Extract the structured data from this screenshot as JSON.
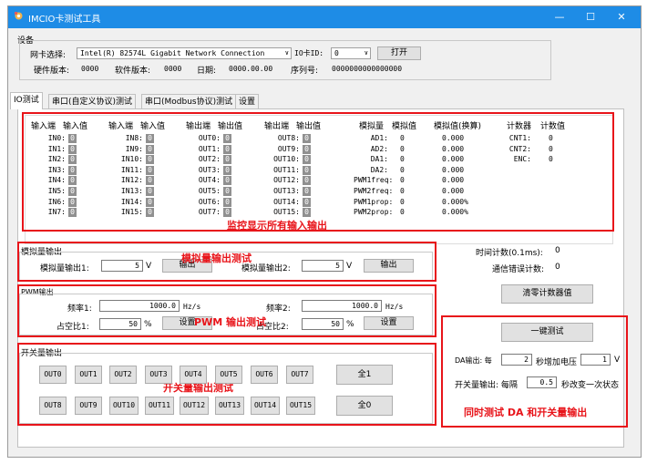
{
  "window": {
    "title": "IMCIO卡测试工具",
    "min_glyph": "—",
    "max_glyph": "☐",
    "close_glyph": "✕"
  },
  "device": {
    "group_label": "设备",
    "nic_label": "网卡选择:",
    "nic_value": "Intel(R) 82574L Gigabit Network Connection",
    "ioid_label": "IO卡ID:",
    "ioid_value": "0",
    "open_button": "打开",
    "hw_label": "硬件版本:",
    "hw_value": "0000",
    "sw_label": "软件版本:",
    "sw_value": "0000",
    "date_label": "日期:",
    "date_value": "0000.00.00",
    "serial_label": "序列号:",
    "serial_value": "0000000000000000"
  },
  "tabs": [
    "IO测试",
    "串口(自定义协议)测试",
    "串口(Modbus协议)测试",
    "设置"
  ],
  "io_grid": {
    "headers": [
      "输入端",
      "输入值",
      "输入端",
      "输入值",
      "输出端",
      "输出值",
      "输出端",
      "输出值",
      "模拟量",
      "模拟值",
      "模拟值(换算)",
      "计数器",
      "计数值"
    ],
    "in_a": [
      "IN0:",
      "IN1:",
      "IN2:",
      "IN3:",
      "IN4:",
      "IN5:",
      "IN6:",
      "IN7:"
    ],
    "in_b": [
      "IN8:",
      "IN9:",
      "IN10:",
      "IN11:",
      "IN12:",
      "IN13:",
      "IN14:",
      "IN15:"
    ],
    "out_a": [
      "OUT0:",
      "OUT1:",
      "OUT2:",
      "OUT3:",
      "OUT4:",
      "OUT5:",
      "OUT6:",
      "OUT7:"
    ],
    "out_b": [
      "OUT8:",
      "OUT9:",
      "OUT10:",
      "OUT11:",
      "OUT12:",
      "OUT13:",
      "OUT14:",
      "OUT15:"
    ],
    "bit_value": "0",
    "analog": [
      {
        "name": "AD1:",
        "value": "0",
        "converted": "0.000"
      },
      {
        "name": "AD2:",
        "value": "0",
        "converted": "0.000"
      },
      {
        "name": "DA1:",
        "value": "0",
        "converted": "0.000"
      },
      {
        "name": "DA2:",
        "value": "0",
        "converted": "0.000"
      },
      {
        "name": "PWM1freq:",
        "value": "0",
        "converted": "0.000"
      },
      {
        "name": "PWM2freq:",
        "value": "0",
        "converted": "0.000"
      },
      {
        "name": "PWM1prop:",
        "value": "0",
        "converted": "0.000%"
      },
      {
        "name": "PWM2prop:",
        "value": "0",
        "converted": "0.000%"
      }
    ],
    "counters": [
      {
        "name": "CNT1:",
        "value": "0"
      },
      {
        "name": "CNT2:",
        "value": "0"
      },
      {
        "name": "ENC:",
        "value": "0"
      }
    ]
  },
  "annotations": {
    "io_monitor": "监控显示所有输入输出",
    "analog": "模拟量输出测试",
    "pwm": "PWM 输出测试",
    "switch": "开关量输出测试",
    "combined": "同时测试 DA 和开关量输出"
  },
  "analog_out": {
    "group_label": "模拟量输出",
    "out1_label": "模拟量输出1:",
    "out1_value": "5",
    "out2_label": "模拟量输出2:",
    "out2_value": "5",
    "unit": "V",
    "button": "输出"
  },
  "pwm_out": {
    "group_label": "PWM输出",
    "freq1_label": "频率1:",
    "freq1_value": "1000.0",
    "freq2_label": "频率2:",
    "freq2_value": "1000.0",
    "freq_unit": "Hz/s",
    "duty1_label": "占空比1:",
    "duty1_value": "50",
    "duty2_label": "占空比2:",
    "duty2_value": "50",
    "duty_unit": "%",
    "button": "设置"
  },
  "switch_out": {
    "group_label": "开关量输出",
    "row1": [
      "OUT0",
      "OUT1",
      "OUT2",
      "OUT3",
      "OUT4",
      "OUT5",
      "OUT6",
      "OUT7"
    ],
    "row2": [
      "OUT8",
      "OUT9",
      "OUT10",
      "OUT11",
      "OUT12",
      "OUT13",
      "OUT14",
      "OUT15"
    ],
    "all_on": "全1",
    "all_off": "全0"
  },
  "stats": {
    "time_label": "时间计数(0.1ms):",
    "time_value": "0",
    "err_label": "通信错误计数:",
    "err_value": "0",
    "clear_button": "清零计数器值"
  },
  "combined_test": {
    "button": "一键测试",
    "da_prefix": "DA输出: 每",
    "da_interval": "2",
    "da_middle": "秒增加电压",
    "da_step": "1",
    "da_unit": "V",
    "sw_prefix": "开关量输出: 每隔",
    "sw_interval": "0.5",
    "sw_suffix": "秒改变一次状态"
  },
  "colors": {
    "titlebar": "#1e8ce6",
    "annotation": "#e8141a"
  }
}
